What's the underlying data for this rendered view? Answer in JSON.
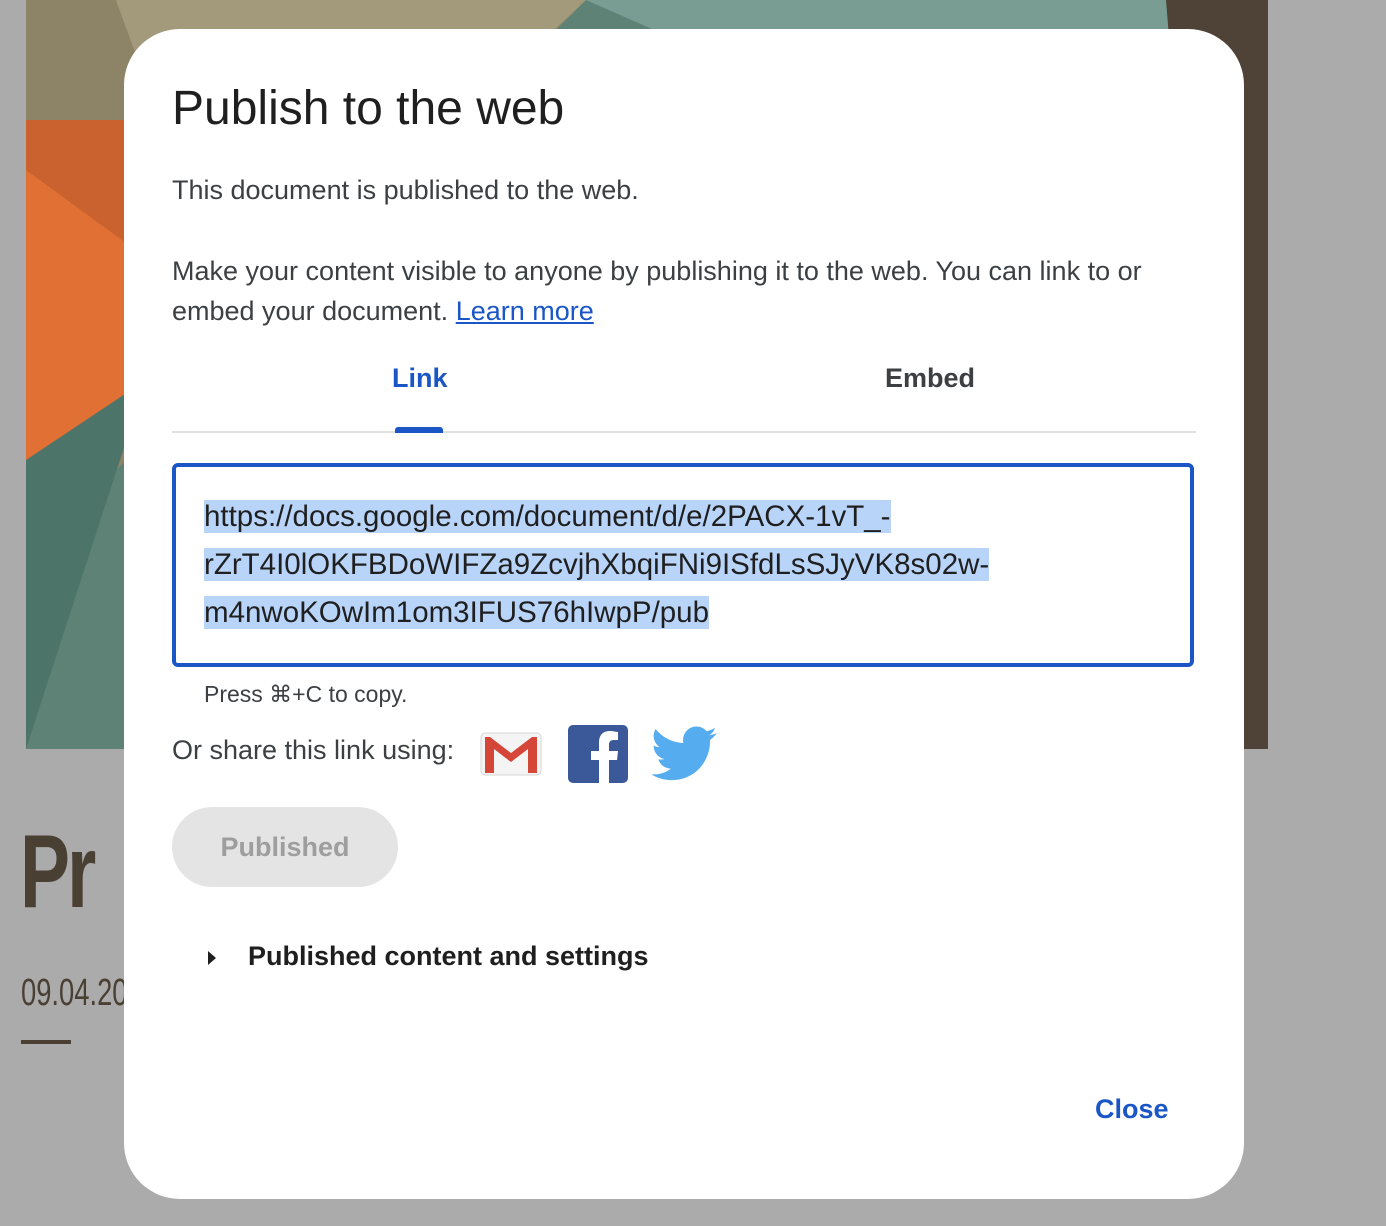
{
  "background": {
    "title_fragment": "Pr",
    "date_fragment": "09.04.20"
  },
  "dialog": {
    "title": "Publish to the web",
    "status": "This document is published to the web.",
    "description": "Make your content visible to anyone by publishing it to the web. You can link to or embed your document.",
    "learn_more": "Learn more",
    "tabs": [
      {
        "label": "Link",
        "active": true
      },
      {
        "label": "Embed",
        "active": false
      }
    ],
    "link": {
      "line1": "https://docs.google.com/document/d/e/2PACX-1vT_-",
      "line2": "rZrT4I0lOKFBDoWIFZa9ZcvjhXbqiFNi9ISfdLsSJyVK8s02w-",
      "line3": "m4nwoKOwIm1om3IFUS76hIwpP/pub"
    },
    "copy_hint": "Press ⌘+C to copy.",
    "share_label": "Or share this link using:",
    "share_icons": [
      "gmail-icon",
      "facebook-icon",
      "twitter-icon"
    ],
    "published_button": "Published",
    "settings_expander": "Published content and settings",
    "close_button": "Close"
  },
  "colors": {
    "accent": "#1a56c6",
    "selection": "#b9d4f9",
    "overlay": "#ababab"
  }
}
